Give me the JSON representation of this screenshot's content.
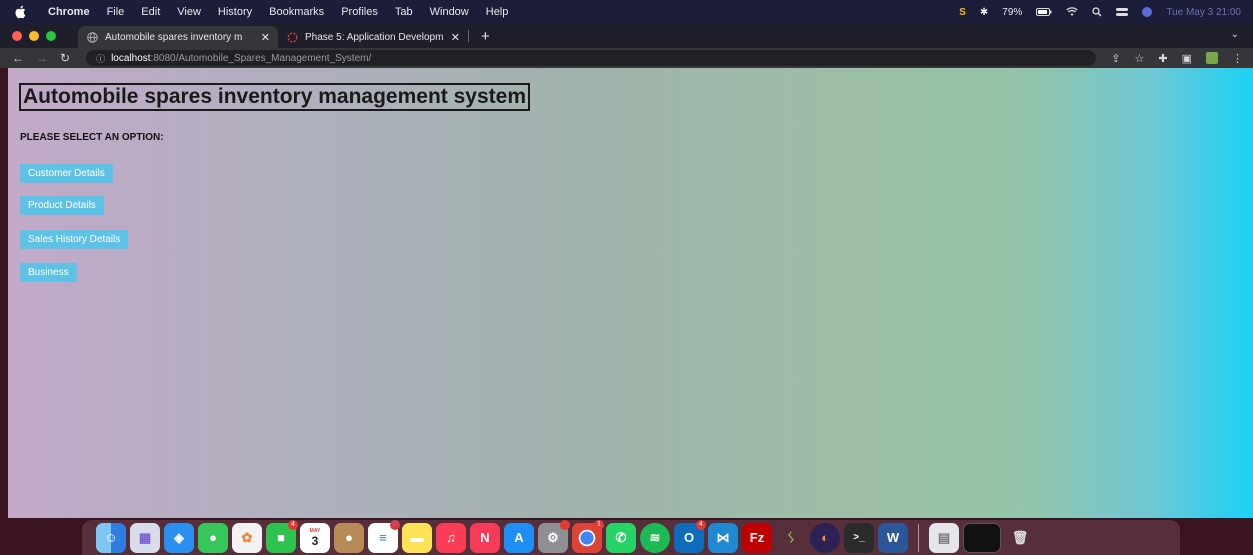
{
  "menubar": {
    "app": "Chrome",
    "items": [
      "File",
      "Edit",
      "View",
      "History",
      "Bookmarks",
      "Profiles",
      "Tab",
      "Window",
      "Help"
    ],
    "battery": "79%",
    "clock": "Tue May 3  21:00"
  },
  "tabs": [
    {
      "title": "Automobile spares inventory m",
      "close": "✕"
    },
    {
      "title": "Phase 5: Application Developm",
      "close": "✕"
    }
  ],
  "newtab": "+",
  "address": {
    "host": "localhost",
    "path": ":8080/Automobile_Spares_Management_System/"
  },
  "page": {
    "title": "Automobile spares inventory management system",
    "prompt": "PLEASE SELECT AN OPTION:",
    "options": [
      "Customer Details",
      "Product Details",
      "Sales History Details",
      "Business"
    ]
  },
  "dock": {
    "calendar_day": "3",
    "calendar_month": "MAY",
    "badges": {
      "messages": "4",
      "reminders": "3",
      "chrome": "1",
      "outlook": "4"
    }
  },
  "colors": {
    "button": "#5ec2e6",
    "gradient_start": "#c2a9c9",
    "gradient_end": "#19d2f5"
  }
}
